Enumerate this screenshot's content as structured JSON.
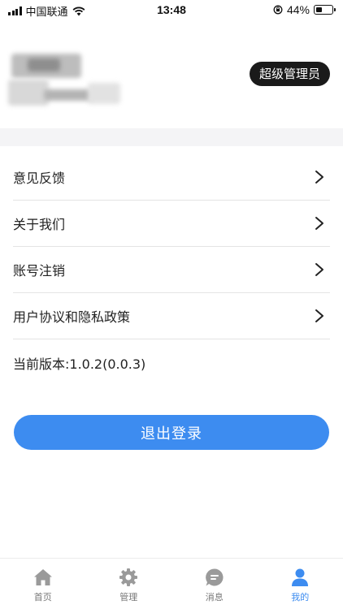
{
  "status_bar": {
    "carrier": "中国联通",
    "time": "13:48",
    "battery": "44%",
    "battery_level": 0.44
  },
  "profile": {
    "role_badge": "超级管理员"
  },
  "menu": {
    "items": [
      {
        "label": "意见反馈"
      },
      {
        "label": "关于我们"
      },
      {
        "label": "账号注销"
      },
      {
        "label": "用户协议和隐私政策"
      }
    ],
    "version": "当前版本:1.0.2(0.0.3)"
  },
  "logout_label": "退出登录",
  "tabbar": {
    "tabs": [
      {
        "label": "首页",
        "icon": "home-icon",
        "active": false
      },
      {
        "label": "管理",
        "icon": "gear-icon",
        "active": false
      },
      {
        "label": "消息",
        "icon": "message-icon",
        "active": false
      },
      {
        "label": "我的",
        "icon": "user-icon",
        "active": true
      }
    ]
  },
  "colors": {
    "accent": "#3d8cf0",
    "badge_bg": "#1a1a1a",
    "inactive_icon": "#9a9a9a"
  }
}
